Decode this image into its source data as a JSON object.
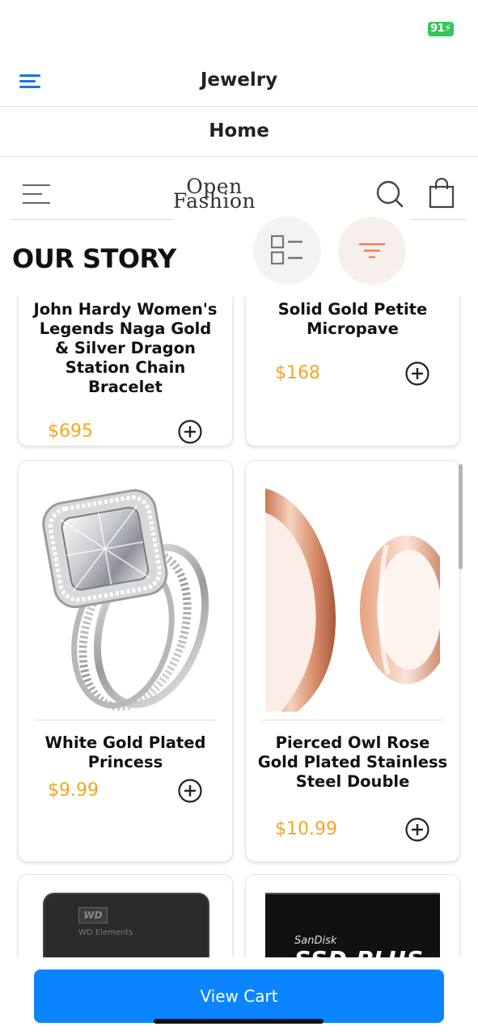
{
  "status_bar": {
    "battery": "91"
  },
  "header": {
    "title": "Jewelry",
    "menu_icon": "hamburger-menu-icon"
  },
  "nav": {
    "home_label": "Home"
  },
  "store": {
    "logo_line1": "Open",
    "logo_line2": "Fashion",
    "menu_icon": "hamburger-menu-icon",
    "search_icon": "search-icon",
    "bag_icon": "shopping-bag-icon"
  },
  "section_title": "OUR STORY",
  "controls": {
    "view_toggle_icon": "list-view-icon",
    "filter_icon": "filter-icon"
  },
  "products": [
    {
      "title": "John Hardy Women's Legends Naga Gold & Silver Dragon Station Chain Bracelet",
      "price": "$695"
    },
    {
      "title": "Solid Gold Petite Micropave",
      "price": "$168"
    },
    {
      "title": "White Gold Plated Princess",
      "price": "$9.99"
    },
    {
      "title": "Pierced Owl Rose Gold Plated Stainless Steel Double",
      "price": "$10.99"
    },
    {
      "title": "",
      "price": "",
      "image_text": "WD Elements"
    },
    {
      "title": "",
      "price": "",
      "image_text_1": "SanDisk",
      "image_text_2": "SSD PLUS"
    }
  ],
  "accent_color": "#f5a623",
  "primary_color": "#0a84ff",
  "cart": {
    "button_label": "View Cart"
  }
}
